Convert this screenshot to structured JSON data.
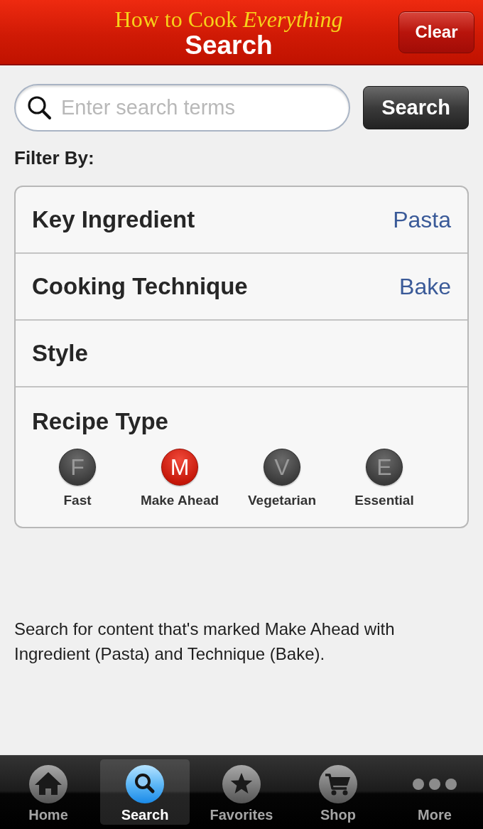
{
  "header": {
    "brand": "How to Cook *Everything*",
    "title": "Search",
    "clear_button": "Clear"
  },
  "search": {
    "placeholder": "Enter search terms",
    "button": "Search"
  },
  "filter": {
    "heading": "Filter By:",
    "rows": [
      {
        "label": "Key Ingredient",
        "value": "Pasta"
      },
      {
        "label": "Cooking Technique",
        "value": "Bake"
      },
      {
        "label": "Style"
      }
    ],
    "recipe_type": {
      "label": "Recipe Type",
      "options": [
        {
          "letter": "F",
          "label": "Fast",
          "selected": false
        },
        {
          "letter": "M",
          "label": "Make Ahead",
          "selected": true
        },
        {
          "letter": "V",
          "label": "Vegetarian",
          "selected": false
        },
        {
          "letter": "E",
          "label": "Essential",
          "selected": false
        }
      ]
    }
  },
  "description": "Search for content that's marked Make Ahead with Ingredient (Pasta) and Technique (Bake).",
  "tab_bar": [
    {
      "kind": "home",
      "label": "Home",
      "selected": false
    },
    {
      "kind": "search",
      "label": "Search",
      "selected": true
    },
    {
      "kind": "favorites",
      "label": "Favorites",
      "selected": false
    },
    {
      "kind": "shop",
      "label": "Shop",
      "selected": false
    },
    {
      "kind": "more",
      "label": "More",
      "selected": false
    }
  ]
}
